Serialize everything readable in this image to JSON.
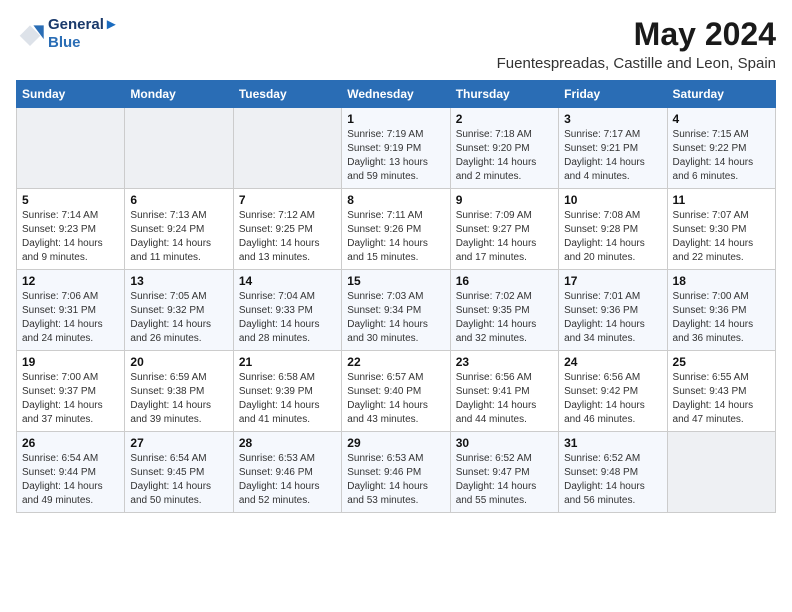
{
  "logo": {
    "line1": "General",
    "line2": "Blue"
  },
  "title": "May 2024",
  "subtitle": "Fuentespreadas, Castille and Leon, Spain",
  "weekdays": [
    "Sunday",
    "Monday",
    "Tuesday",
    "Wednesday",
    "Thursday",
    "Friday",
    "Saturday"
  ],
  "weeks": [
    [
      {
        "day": "",
        "sunrise": "",
        "sunset": "",
        "daylight": ""
      },
      {
        "day": "",
        "sunrise": "",
        "sunset": "",
        "daylight": ""
      },
      {
        "day": "",
        "sunrise": "",
        "sunset": "",
        "daylight": ""
      },
      {
        "day": "1",
        "sunrise": "Sunrise: 7:19 AM",
        "sunset": "Sunset: 9:19 PM",
        "daylight": "Daylight: 13 hours and 59 minutes."
      },
      {
        "day": "2",
        "sunrise": "Sunrise: 7:18 AM",
        "sunset": "Sunset: 9:20 PM",
        "daylight": "Daylight: 14 hours and 2 minutes."
      },
      {
        "day": "3",
        "sunrise": "Sunrise: 7:17 AM",
        "sunset": "Sunset: 9:21 PM",
        "daylight": "Daylight: 14 hours and 4 minutes."
      },
      {
        "day": "4",
        "sunrise": "Sunrise: 7:15 AM",
        "sunset": "Sunset: 9:22 PM",
        "daylight": "Daylight: 14 hours and 6 minutes."
      }
    ],
    [
      {
        "day": "5",
        "sunrise": "Sunrise: 7:14 AM",
        "sunset": "Sunset: 9:23 PM",
        "daylight": "Daylight: 14 hours and 9 minutes."
      },
      {
        "day": "6",
        "sunrise": "Sunrise: 7:13 AM",
        "sunset": "Sunset: 9:24 PM",
        "daylight": "Daylight: 14 hours and 11 minutes."
      },
      {
        "day": "7",
        "sunrise": "Sunrise: 7:12 AM",
        "sunset": "Sunset: 9:25 PM",
        "daylight": "Daylight: 14 hours and 13 minutes."
      },
      {
        "day": "8",
        "sunrise": "Sunrise: 7:11 AM",
        "sunset": "Sunset: 9:26 PM",
        "daylight": "Daylight: 14 hours and 15 minutes."
      },
      {
        "day": "9",
        "sunrise": "Sunrise: 7:09 AM",
        "sunset": "Sunset: 9:27 PM",
        "daylight": "Daylight: 14 hours and 17 minutes."
      },
      {
        "day": "10",
        "sunrise": "Sunrise: 7:08 AM",
        "sunset": "Sunset: 9:28 PM",
        "daylight": "Daylight: 14 hours and 20 minutes."
      },
      {
        "day": "11",
        "sunrise": "Sunrise: 7:07 AM",
        "sunset": "Sunset: 9:30 PM",
        "daylight": "Daylight: 14 hours and 22 minutes."
      }
    ],
    [
      {
        "day": "12",
        "sunrise": "Sunrise: 7:06 AM",
        "sunset": "Sunset: 9:31 PM",
        "daylight": "Daylight: 14 hours and 24 minutes."
      },
      {
        "day": "13",
        "sunrise": "Sunrise: 7:05 AM",
        "sunset": "Sunset: 9:32 PM",
        "daylight": "Daylight: 14 hours and 26 minutes."
      },
      {
        "day": "14",
        "sunrise": "Sunrise: 7:04 AM",
        "sunset": "Sunset: 9:33 PM",
        "daylight": "Daylight: 14 hours and 28 minutes."
      },
      {
        "day": "15",
        "sunrise": "Sunrise: 7:03 AM",
        "sunset": "Sunset: 9:34 PM",
        "daylight": "Daylight: 14 hours and 30 minutes."
      },
      {
        "day": "16",
        "sunrise": "Sunrise: 7:02 AM",
        "sunset": "Sunset: 9:35 PM",
        "daylight": "Daylight: 14 hours and 32 minutes."
      },
      {
        "day": "17",
        "sunrise": "Sunrise: 7:01 AM",
        "sunset": "Sunset: 9:36 PM",
        "daylight": "Daylight: 14 hours and 34 minutes."
      },
      {
        "day": "18",
        "sunrise": "Sunrise: 7:00 AM",
        "sunset": "Sunset: 9:36 PM",
        "daylight": "Daylight: 14 hours and 36 minutes."
      }
    ],
    [
      {
        "day": "19",
        "sunrise": "Sunrise: 7:00 AM",
        "sunset": "Sunset: 9:37 PM",
        "daylight": "Daylight: 14 hours and 37 minutes."
      },
      {
        "day": "20",
        "sunrise": "Sunrise: 6:59 AM",
        "sunset": "Sunset: 9:38 PM",
        "daylight": "Daylight: 14 hours and 39 minutes."
      },
      {
        "day": "21",
        "sunrise": "Sunrise: 6:58 AM",
        "sunset": "Sunset: 9:39 PM",
        "daylight": "Daylight: 14 hours and 41 minutes."
      },
      {
        "day": "22",
        "sunrise": "Sunrise: 6:57 AM",
        "sunset": "Sunset: 9:40 PM",
        "daylight": "Daylight: 14 hours and 43 minutes."
      },
      {
        "day": "23",
        "sunrise": "Sunrise: 6:56 AM",
        "sunset": "Sunset: 9:41 PM",
        "daylight": "Daylight: 14 hours and 44 minutes."
      },
      {
        "day": "24",
        "sunrise": "Sunrise: 6:56 AM",
        "sunset": "Sunset: 9:42 PM",
        "daylight": "Daylight: 14 hours and 46 minutes."
      },
      {
        "day": "25",
        "sunrise": "Sunrise: 6:55 AM",
        "sunset": "Sunset: 9:43 PM",
        "daylight": "Daylight: 14 hours and 47 minutes."
      }
    ],
    [
      {
        "day": "26",
        "sunrise": "Sunrise: 6:54 AM",
        "sunset": "Sunset: 9:44 PM",
        "daylight": "Daylight: 14 hours and 49 minutes."
      },
      {
        "day": "27",
        "sunrise": "Sunrise: 6:54 AM",
        "sunset": "Sunset: 9:45 PM",
        "daylight": "Daylight: 14 hours and 50 minutes."
      },
      {
        "day": "28",
        "sunrise": "Sunrise: 6:53 AM",
        "sunset": "Sunset: 9:46 PM",
        "daylight": "Daylight: 14 hours and 52 minutes."
      },
      {
        "day": "29",
        "sunrise": "Sunrise: 6:53 AM",
        "sunset": "Sunset: 9:46 PM",
        "daylight": "Daylight: 14 hours and 53 minutes."
      },
      {
        "day": "30",
        "sunrise": "Sunrise: 6:52 AM",
        "sunset": "Sunset: 9:47 PM",
        "daylight": "Daylight: 14 hours and 55 minutes."
      },
      {
        "day": "31",
        "sunrise": "Sunrise: 6:52 AM",
        "sunset": "Sunset: 9:48 PM",
        "daylight": "Daylight: 14 hours and 56 minutes."
      },
      {
        "day": "",
        "sunrise": "",
        "sunset": "",
        "daylight": ""
      }
    ]
  ]
}
